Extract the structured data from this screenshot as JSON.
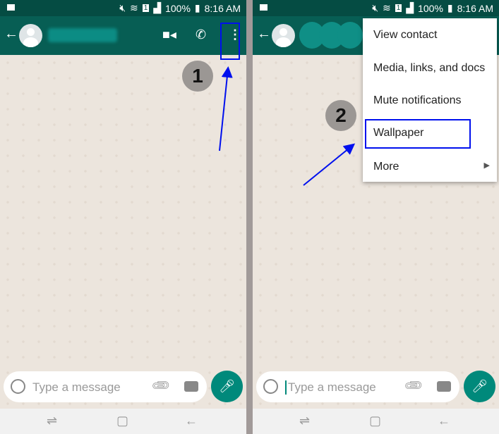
{
  "status": {
    "battery": "100%",
    "time": "8:16 AM",
    "sim": "1"
  },
  "input": {
    "placeholder": "Type a message"
  },
  "steps": [
    "1",
    "2"
  ],
  "menu": {
    "items": [
      "View contact",
      "Media, links, and docs",
      "Mute notifications",
      "Wallpaper",
      "More"
    ]
  },
  "colors": {
    "header": "#075e54",
    "accent": "#00897b",
    "highlight": "#0010ee",
    "chat_bg": "#ece5dd"
  }
}
